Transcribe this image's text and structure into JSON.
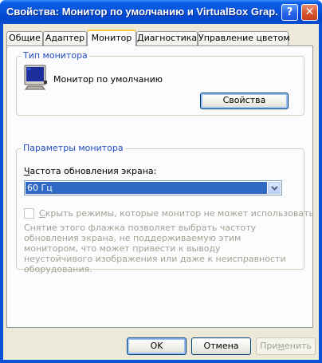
{
  "window": {
    "title": "Свойства: Монитор по умолчанию и VirtualBox Grap...",
    "help_glyph": "?",
    "close_glyph": "✕"
  },
  "tabs": [
    {
      "label": "Общие",
      "active": false
    },
    {
      "label": "Адаптер",
      "active": false
    },
    {
      "label": "Монитор",
      "active": true
    },
    {
      "label": "Диагностика",
      "active": false
    },
    {
      "label": "Управление цветом",
      "active": false
    }
  ],
  "monitor_type": {
    "group_label": "Тип монитора",
    "monitor_name": "Монитор по умолчанию",
    "properties_button": "Свойства",
    "icon": "monitor-icon"
  },
  "monitor_settings": {
    "group_label": "Параметры монитора",
    "refresh_label_prefix": "",
    "refresh_label_accel": "Ч",
    "refresh_label_rest": "астота обновления экрана:",
    "refresh_value": "60 Гц",
    "hide_modes_accel": "С",
    "hide_modes_rest": "крыть режимы, которые монитор не может использовать",
    "hide_modes_checked": false,
    "hint": "Снятие этого флажка позволяет выбрать частоту обновления экрана, не поддерживаемую этим монитором, что может привести к выводу неустойчивого изображения или даже к неисправности оборудования."
  },
  "buttons": {
    "ok": "OK",
    "cancel": "Отмена",
    "apply_prefix": "При",
    "apply_accel": "м",
    "apply_rest": "енить"
  },
  "colors": {
    "titlebar": "#0653dd",
    "dialog_face": "#ece9d8",
    "group_label": "#1f4cc2",
    "selection": "#316ac5",
    "active_tab_accent": "#ffc83c"
  }
}
